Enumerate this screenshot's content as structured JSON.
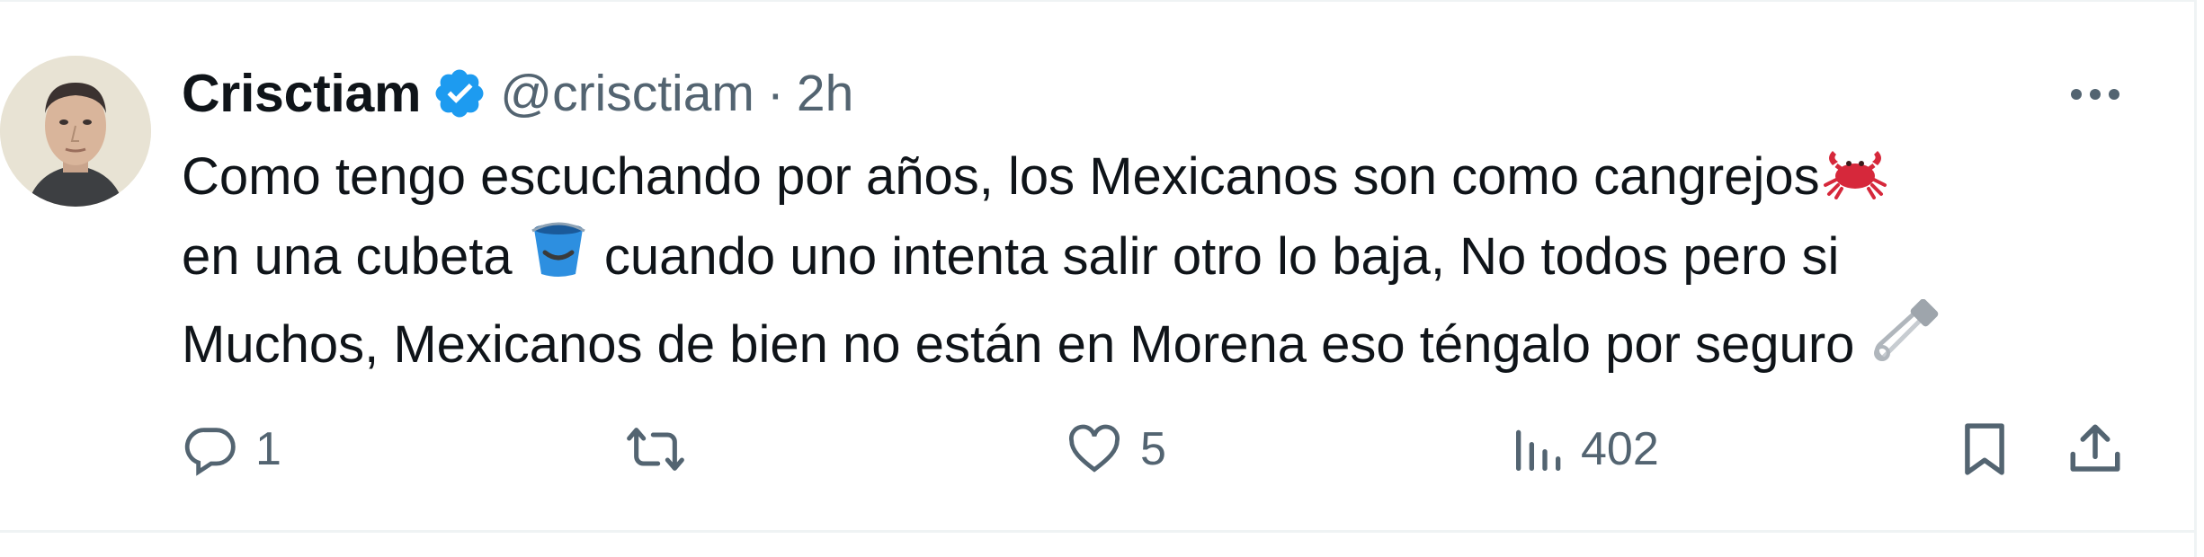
{
  "tweet": {
    "author": {
      "display_name": "Crisctiam",
      "handle": "@crisctiam",
      "verified": true,
      "verified_color": "#1d9bf0"
    },
    "separator": "·",
    "timestamp": "2h",
    "text_lines": [
      "Como tengo escuchando por años, los Mexicanos son como cangrejos",
      "en una cubeta",
      "cuando uno intenta salir otro lo baja, No todos pero si",
      "Muchos, Mexicanos de bien no están en Morena eso téngalo por seguro"
    ],
    "emojis": [
      "crab-emoji",
      "bucket-emoji",
      "safety-pin-emoji"
    ],
    "actions": {
      "replies": "1",
      "reposts": "",
      "likes": "5",
      "views": "402"
    }
  },
  "colors": {
    "text": "#0f1419",
    "secondary": "#536471",
    "border": "#eff3f4"
  }
}
